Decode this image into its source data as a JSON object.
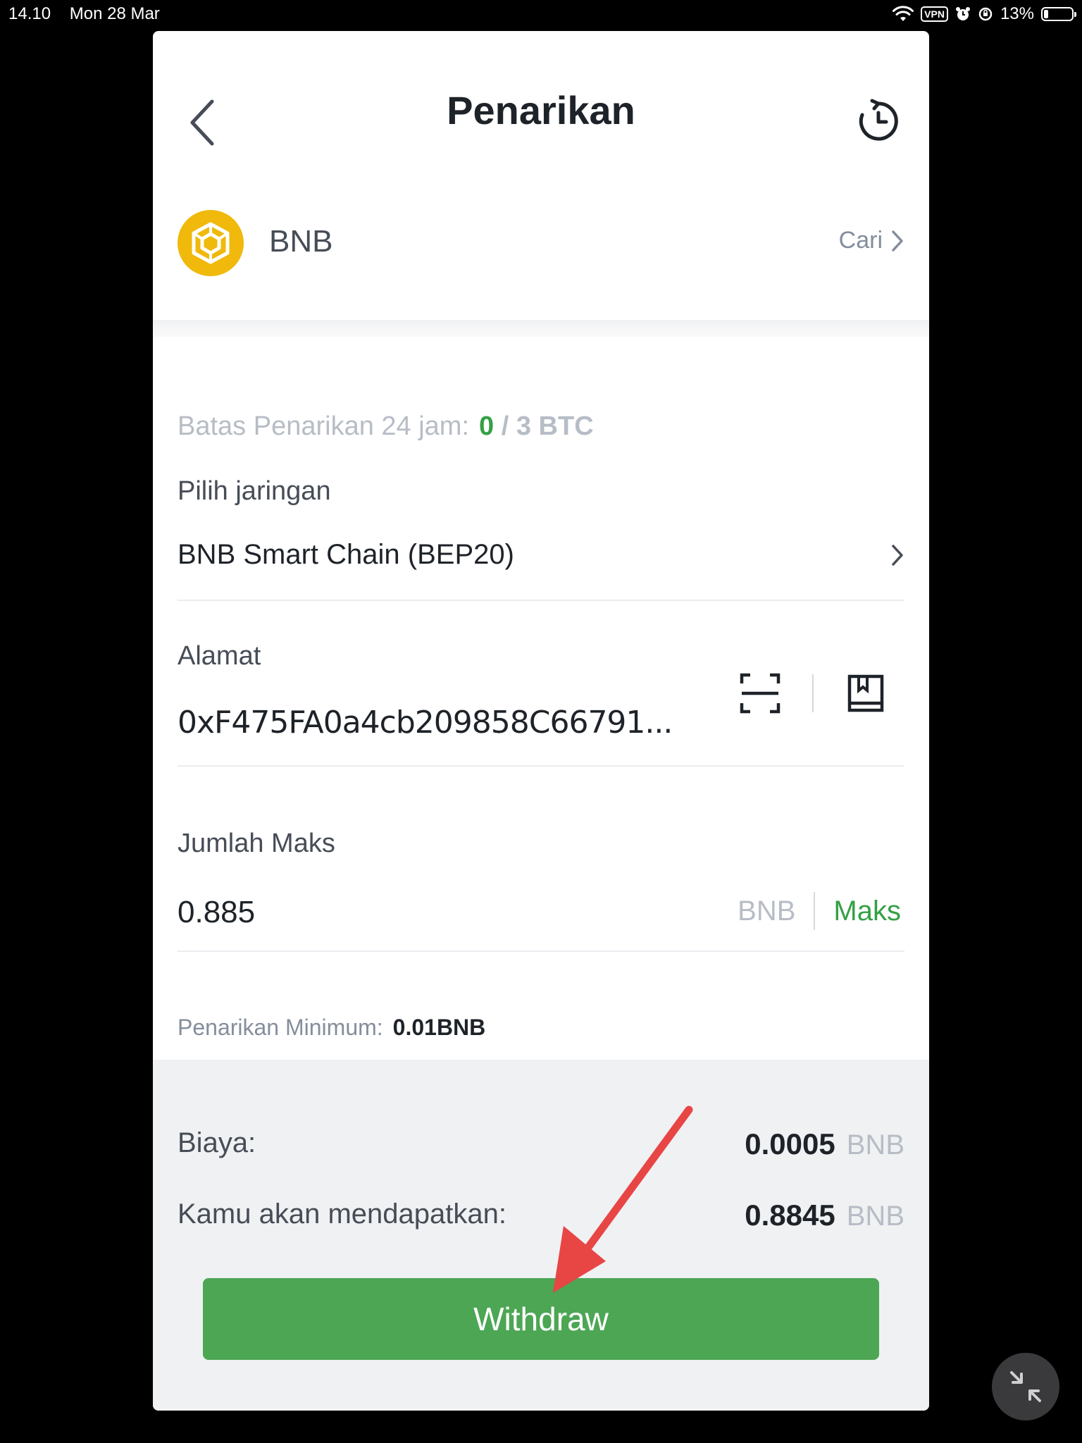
{
  "status_bar": {
    "time": "14.10",
    "date": "Mon 28 Mar",
    "vpn": "VPN",
    "battery": "13%"
  },
  "header": {
    "title": "Penarikan"
  },
  "coin": {
    "name": "BNB",
    "search_label": "Cari",
    "logo_color": "#f0b90b"
  },
  "limit": {
    "label": "Batas Penarikan 24 jam:",
    "used": "0",
    "separator": "/",
    "max": "3 BTC"
  },
  "network": {
    "label": "Pilih jaringan",
    "value": "BNB Smart Chain (BEP20)"
  },
  "address": {
    "label": "Alamat",
    "value": "0xF475FA0a4cb209858C66791..."
  },
  "amount": {
    "label": "Jumlah Maks",
    "value": "0.885",
    "unit": "BNB",
    "max_label": "Maks"
  },
  "minimum": {
    "label": "Penarikan Minimum:",
    "value": "0.01BNB"
  },
  "fee": {
    "label": "Biaya:",
    "value": "0.0005",
    "unit": "BNB"
  },
  "receive": {
    "label": "Kamu akan mendapatkan:",
    "value": "0.8845",
    "unit": "BNB"
  },
  "withdraw": {
    "label": "Withdraw",
    "color": "#4ca654"
  },
  "colors": {
    "accent_green": "#35a045",
    "annotation_arrow": "#e84545"
  }
}
